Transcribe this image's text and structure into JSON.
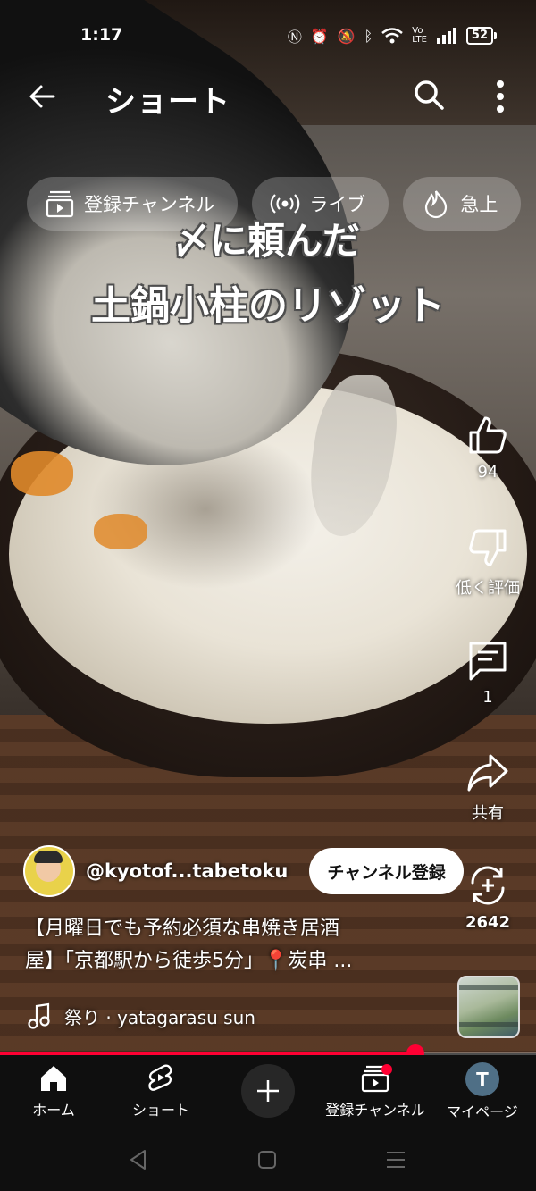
{
  "status_bar": {
    "time": "1:17",
    "battery": "52"
  },
  "header": {
    "title": "ショート"
  },
  "chips": [
    {
      "label": "登録チャンネル",
      "icon": "subscriptions-icon"
    },
    {
      "label": "ライブ",
      "icon": "live-icon"
    },
    {
      "label": "急上",
      "icon": "trending-icon"
    }
  ],
  "overlay_caption": {
    "line1": "〆に頼んだ",
    "line2": "土鍋小柱のリゾット"
  },
  "actions": {
    "like_count": "94",
    "dislike_label": "低く評価",
    "comment_count": "1",
    "share_label": "共有",
    "remix_count": "2642"
  },
  "channel": {
    "handle": "@kyotof...tabetoku",
    "subscribe_label": "チャンネル登録"
  },
  "description": {
    "line1": "【月曜日でも予約必須な串焼き居酒",
    "line2": "屋】「京都駅から徒歩5分」📍炭串 ..."
  },
  "music": {
    "text": "祭り · yatagarasu sun"
  },
  "progress": {
    "fraction": 0.775
  },
  "bottom_nav": {
    "home": "ホーム",
    "shorts": "ショート",
    "subscriptions": "登録チャンネル",
    "you": "マイページ",
    "avatar_initial": "T"
  },
  "colors": {
    "accent": "#ff0033",
    "nav_bg": "#0f0f0f"
  }
}
